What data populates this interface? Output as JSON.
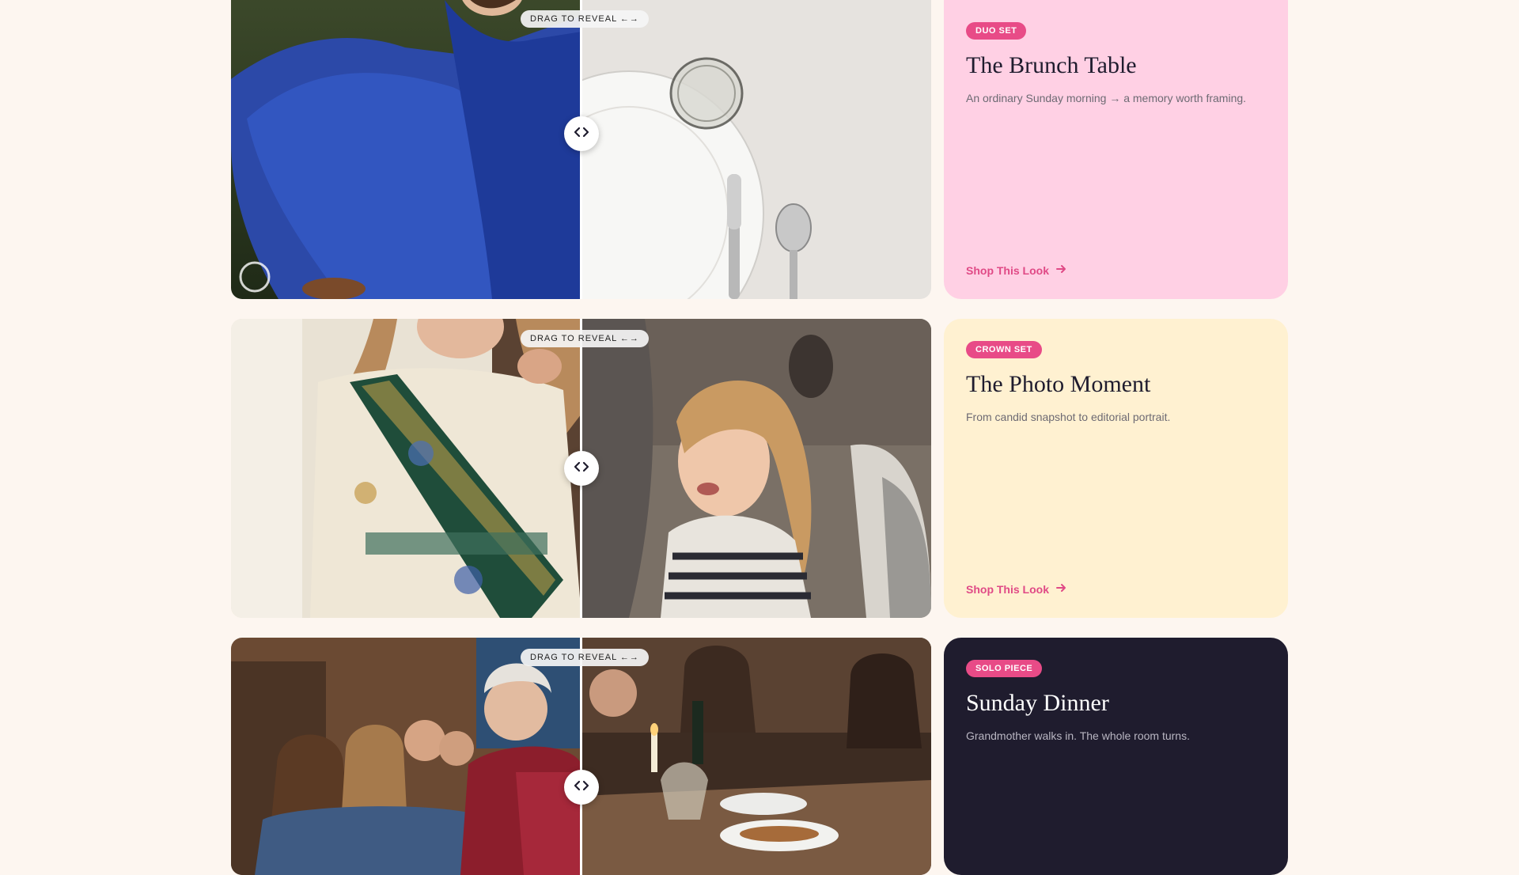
{
  "compare": {
    "reveal_label": "DRAG TO REVEAL ←→"
  },
  "looks": [
    {
      "badge": "DUO SET",
      "title": "The Brunch Table",
      "description": "An ordinary Sunday morning → a memory worth framing.",
      "cta": "Shop This Look",
      "theme": "pink"
    },
    {
      "badge": "CROWN SET",
      "title": "The Photo Moment",
      "description": "From candid snapshot to editorial portrait.",
      "cta": "Shop This Look",
      "theme": "cream"
    },
    {
      "badge": "SOLO PIECE",
      "title": "Sunday Dinner",
      "description": "Grandmother walks in. The whole room turns.",
      "cta": "",
      "theme": "dark"
    }
  ],
  "colors": {
    "page_bg": "#fdf6f0",
    "accent": "#e84b87",
    "pink_card": "#ffd0e4",
    "cream_card": "#fff1d1",
    "dark_card": "#1f1c2e"
  },
  "icons": {
    "handle": "chevron-left-right-icon",
    "cta_arrow": "arrow-right-icon"
  }
}
